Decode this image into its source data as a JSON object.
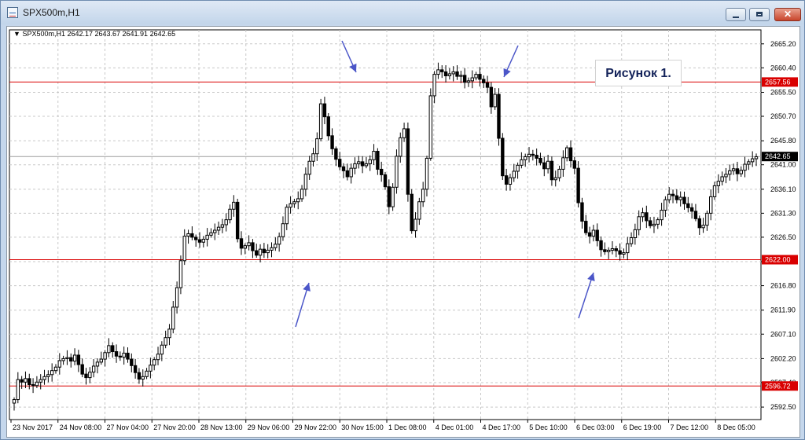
{
  "window": {
    "title": "SPX500m,H1",
    "controls": [
      "minimize",
      "maximize",
      "close"
    ]
  },
  "chart": {
    "info": "SPX500m,H1  2642.17 2643.67 2641.91 2642.65",
    "figure_label": "Рисунок 1."
  },
  "colors": {
    "background": "#ffffff",
    "grid": "#c8c8c8",
    "level_line": "#d90000",
    "current_price_line": "#9e9e9e",
    "candle": "#000000",
    "arrow": "#4b56c8"
  },
  "chart_data": {
    "type": "candlestick",
    "symbol": "SPX500m",
    "timeframe": "H1",
    "ylim": [
      2590,
      2668
    ],
    "y_ticks": [
      "2665.20",
      "2660.40",
      "2655.50",
      "2650.70",
      "2645.80",
      "2641.00",
      "2636.10",
      "2631.30",
      "2626.50",
      "2621.60",
      "2616.80",
      "2611.90",
      "2607.10",
      "2602.20",
      "2597.40",
      "2592.50"
    ],
    "x_ticks": [
      "23 Nov 2017",
      "24 Nov 08:00",
      "27 Nov 04:00",
      "27 Nov 20:00",
      "28 Nov 13:00",
      "29 Nov 06:00",
      "29 Nov 22:00",
      "30 Nov 15:00",
      "1 Dec 08:00",
      "4 Dec 01:00",
      "4 Dec 17:00",
      "5 Dec 10:00",
      "6 Dec 03:00",
      "6 Dec 19:00",
      "7 Dec 12:00",
      "8 Dec 05:00"
    ],
    "levels": [
      {
        "label": "2657.56",
        "value": 2657.56
      },
      {
        "label": "2622.00",
        "value": 2622.0
      },
      {
        "label": "2596.72",
        "value": 2596.72
      }
    ],
    "current_price": {
      "label": "2642.65",
      "value": 2642.65
    },
    "series": [
      {
        "name": "",
        "values": [
          2594.0,
          2598.0,
          2597.5,
          2598.2,
          2597.0,
          2596.8,
          2597.5,
          2598.0,
          2598.6,
          2599.0,
          2599.8,
          2600.5,
          2601.8,
          2602.2,
          2602.4,
          2601.7,
          2602.9,
          2601.0,
          2599.1,
          2598.4,
          2599.5,
          2600.7,
          2601.5,
          2602.1,
          2603.4,
          2604.8,
          2603.6,
          2602.7,
          2602.5,
          2603.3,
          2602.1,
          2600.8,
          2599.4,
          2598.1,
          2598.6,
          2599.7,
          2600.9,
          2602.0,
          2603.1,
          2604.9,
          2606.4,
          2608.1,
          2612.5,
          2616.4,
          2621.8,
          2626.7,
          2627.2,
          2626.5,
          2626.0,
          2625.5,
          2626.1,
          2626.9,
          2627.4,
          2627.9,
          2628.5,
          2629.0,
          2630.0,
          2632.1,
          2633.5,
          2626.2,
          2624.3,
          2624.8,
          2625.4,
          2623.8,
          2622.9,
          2624.1,
          2623.4,
          2623.9,
          2624.4,
          2625.1,
          2626.6,
          2629.2,
          2632.5,
          2633.2,
          2633.6,
          2634.2,
          2636.1,
          2639.1,
          2641.7,
          2643.2,
          2646.2,
          2653.2,
          2650.6,
          2646.8,
          2644.2,
          2642.1,
          2640.6,
          2639.8,
          2638.6,
          2640.3,
          2641.2,
          2641.6,
          2640.8,
          2641.2,
          2642.0,
          2643.7,
          2640.1,
          2639.0,
          2636.6,
          2632.6,
          2636.5,
          2642.7,
          2646.4,
          2648.2,
          2635.1,
          2627.8,
          2630.1,
          2633.6,
          2636.1,
          2642.3,
          2654.8,
          2659.1,
          2660.0,
          2659.6,
          2658.8,
          2659.2,
          2659.6,
          2658.7,
          2658.9,
          2657.5,
          2657.8,
          2658.4,
          2659.1,
          2658.1,
          2657.4,
          2656.5,
          2652.6,
          2655.1,
          2646.3,
          2638.8,
          2637.1,
          2638.4,
          2639.7,
          2640.9,
          2642.0,
          2642.6,
          2643.1,
          2642.9,
          2642.3,
          2641.4,
          2640.2,
          2641.7,
          2638.0,
          2638.4,
          2640.1,
          2642.4,
          2644.4,
          2641.8,
          2640.3,
          2633.4,
          2629.7,
          2627.4,
          2626.7,
          2627.9,
          2625.8,
          2624.0,
          2623.6,
          2623.9,
          2624.2,
          2623.8,
          2623.1,
          2623.4,
          2625.2,
          2626.4,
          2628.0,
          2630.6,
          2631.4,
          2629.8,
          2628.8,
          2629.1,
          2630.0,
          2631.9,
          2634.0,
          2635.1,
          2634.8,
          2634.0,
          2634.5,
          2633.2,
          2632.4,
          2631.7,
          2630.2,
          2628.4,
          2628.9,
          2631.3,
          2634.6,
          2636.8,
          2637.7,
          2638.6,
          2639.1,
          2639.8,
          2640.2,
          2639.2,
          2639.9,
          2641.1,
          2641.6,
          2642.2,
          2642.6
        ]
      }
    ],
    "annotations": [
      "arrow to top resistance",
      "arrow to top resistance",
      "arrow to support",
      "arrow to support"
    ]
  }
}
